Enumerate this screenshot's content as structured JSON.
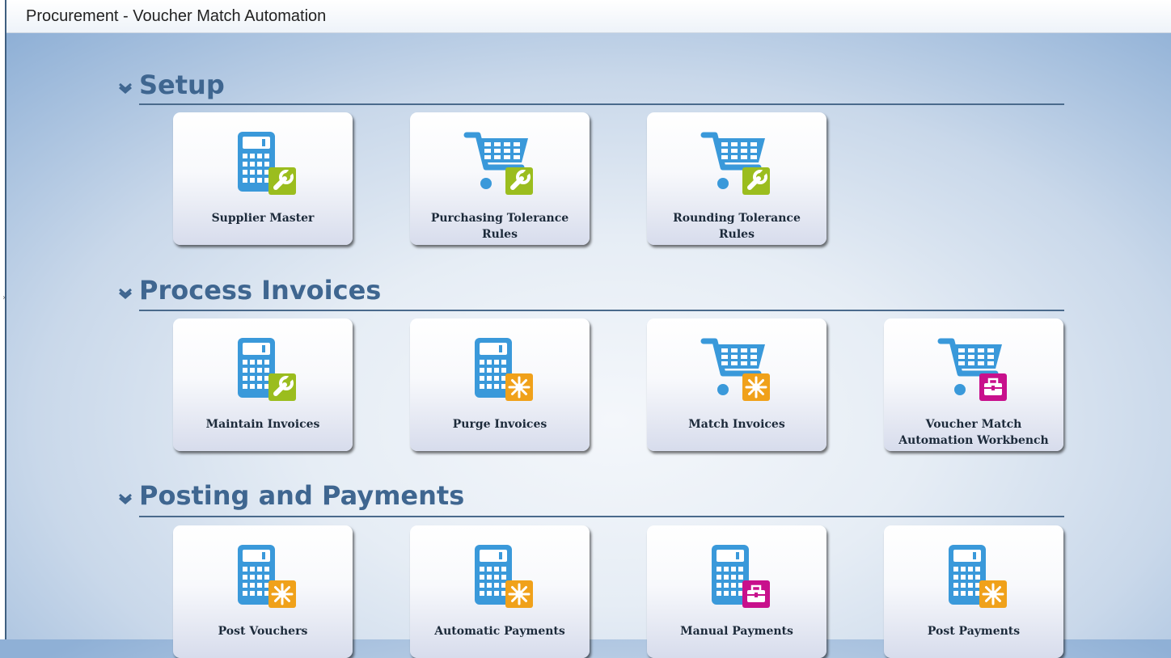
{
  "window": {
    "title": "Procurement - Voucher Match Automation"
  },
  "colors": {
    "heading": "#3f6690",
    "icon_blue": "#3a99da",
    "badge_green": "#9bbd1e",
    "badge_orange": "#f0a11a",
    "badge_magenta": "#c8108c"
  },
  "sections": [
    {
      "heading": "Setup",
      "tiles": [
        {
          "label": "Supplier Master",
          "icon": "calculator-icon",
          "badge": "wrench-badge"
        },
        {
          "label": "Purchasing Tolerance Rules",
          "icon": "shopping-cart-icon",
          "badge": "wrench-badge"
        },
        {
          "label": "Rounding Tolerance Rules",
          "icon": "shopping-cart-icon",
          "badge": "wrench-badge"
        }
      ]
    },
    {
      "heading": "Process Invoices",
      "tiles": [
        {
          "label": "Maintain Invoices",
          "icon": "calculator-icon",
          "badge": "wrench-badge"
        },
        {
          "label": "Purge Invoices",
          "icon": "calculator-icon",
          "badge": "burst-badge"
        },
        {
          "label": "Match Invoices",
          "icon": "shopping-cart-icon",
          "badge": "burst-badge"
        },
        {
          "label": "Voucher Match Automation Workbench",
          "icon": "shopping-cart-icon",
          "badge": "toolbox-badge"
        }
      ]
    },
    {
      "heading": "Posting and Payments",
      "tiles": [
        {
          "label": "Post Vouchers",
          "icon": "calculator-icon",
          "badge": "burst-badge"
        },
        {
          "label": "Automatic Payments",
          "icon": "calculator-icon",
          "badge": "burst-badge"
        },
        {
          "label": "Manual Payments",
          "icon": "calculator-icon",
          "badge": "toolbox-badge"
        },
        {
          "label": "Post Payments",
          "icon": "calculator-icon",
          "badge": "burst-badge"
        }
      ]
    }
  ]
}
